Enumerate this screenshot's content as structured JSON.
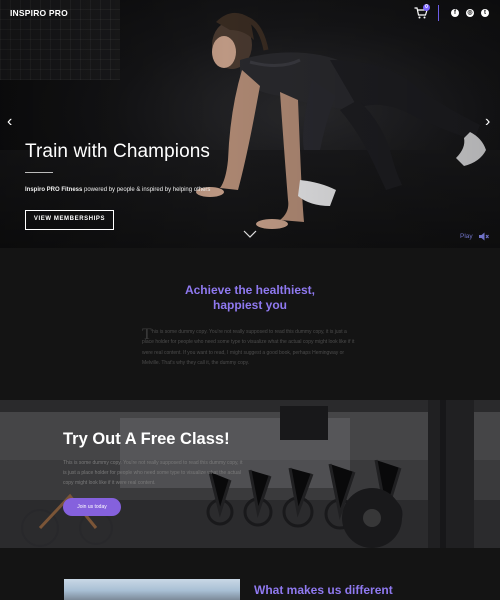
{
  "header": {
    "logo": "INSPIRO PRO",
    "cart_count": "0",
    "social": [
      {
        "name": "facebook-icon",
        "glyph": "f"
      },
      {
        "name": "instagram-icon",
        "glyph": "◎"
      },
      {
        "name": "twitter-icon",
        "glyph": "t"
      }
    ],
    "accent": "#6c5ce7"
  },
  "hero": {
    "title": "Train with Champions",
    "subtitle_brand": "Inspiro PRO Fitness",
    "subtitle_rest": " powered by people & inspired by helping others",
    "cta_label": "VIEW MEMBERSHIPS",
    "prev_glyph": "‹",
    "next_glyph": "›",
    "play_label": "Play"
  },
  "about": {
    "heading_line1": "Achieve the healthiest,",
    "heading_line2": "happiest you",
    "dropcap": "T",
    "copy": "his is some dummy copy. You're not really supposed to read this dummy copy, it is just a place holder for people who need some type to visualize what the actual copy might look like if it were real content. If you want to read, I might suggest a good book, perhaps Hemingway or Melville. That's why they call it, the dummy copy.",
    "heading_color": "#8f79f0"
  },
  "free_class": {
    "title": "Try Out A Free Class!",
    "copy": "This is some dummy copy. You're not really supposed to read this dummy copy, it is just a place holder for people who need some type to visualize what the actual copy might look like if it were real content.",
    "button_label": "Join us today",
    "button_color": "#8561dd"
  },
  "different": {
    "heading": "What makes us different"
  }
}
